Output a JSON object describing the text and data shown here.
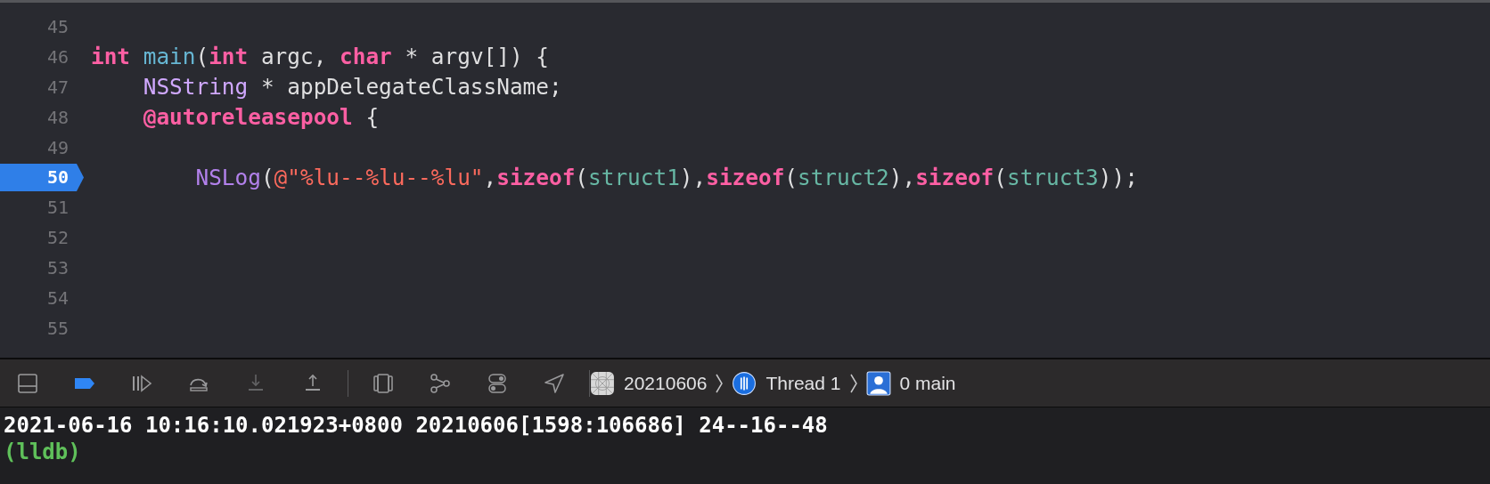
{
  "editor": {
    "lines": [
      {
        "number": "45",
        "breakpoint": false
      },
      {
        "number": "46",
        "breakpoint": false,
        "tokens": [
          {
            "text": "int",
            "kind": "keyword"
          },
          {
            "text": " main",
            "kind": "function"
          },
          {
            "text": "(",
            "kind": "plain"
          },
          {
            "text": "int",
            "kind": "keyword"
          },
          {
            "text": " argc, ",
            "kind": "plain"
          },
          {
            "text": "char",
            "kind": "keyword"
          },
          {
            "text": " * argv[]) {",
            "kind": "plain"
          }
        ]
      },
      {
        "number": "47",
        "breakpoint": false,
        "tokens": [
          {
            "text": "    NSString",
            "kind": "class"
          },
          {
            "text": " * appDelegateClassName;",
            "kind": "plain"
          }
        ]
      },
      {
        "number": "48",
        "breakpoint": false,
        "tokens": [
          {
            "text": "    @autoreleasepool",
            "kind": "keyword"
          },
          {
            "text": " {",
            "kind": "plain"
          }
        ]
      },
      {
        "number": "49",
        "breakpoint": false
      },
      {
        "number": "50",
        "breakpoint": true,
        "tokens": [
          {
            "text": "        NSLog",
            "kind": "call"
          },
          {
            "text": "(",
            "kind": "plain"
          },
          {
            "text": "@\"%lu--%lu--%lu\"",
            "kind": "string"
          },
          {
            "text": ",",
            "kind": "plain"
          },
          {
            "text": "sizeof",
            "kind": "keyword"
          },
          {
            "text": "(",
            "kind": "plain"
          },
          {
            "text": "struct1",
            "kind": "identifier"
          },
          {
            "text": "),",
            "kind": "plain"
          },
          {
            "text": "sizeof",
            "kind": "keyword"
          },
          {
            "text": "(",
            "kind": "plain"
          },
          {
            "text": "struct2",
            "kind": "identifier"
          },
          {
            "text": "),",
            "kind": "plain"
          },
          {
            "text": "sizeof",
            "kind": "keyword"
          },
          {
            "text": "(",
            "kind": "plain"
          },
          {
            "text": "struct3",
            "kind": "identifier"
          },
          {
            "text": "));",
            "kind": "plain"
          }
        ]
      },
      {
        "number": "51",
        "breakpoint": false
      },
      {
        "number": "52",
        "breakpoint": false
      },
      {
        "number": "53",
        "breakpoint": false
      },
      {
        "number": "54",
        "breakpoint": false
      },
      {
        "number": "55",
        "breakpoint": false
      }
    ]
  },
  "debug_bar": {
    "buttons": [
      {
        "kind": "panel",
        "active": false,
        "disabled": false
      },
      {
        "kind": "breakpoints",
        "active": true,
        "disabled": false
      },
      {
        "kind": "continue",
        "active": false,
        "disabled": false
      },
      {
        "kind": "step-over",
        "active": false,
        "disabled": false
      },
      {
        "kind": "step-into",
        "active": false,
        "disabled": true
      },
      {
        "kind": "step-out",
        "active": false,
        "disabled": false
      },
      {
        "kind": "view-hierarchy",
        "active": false,
        "disabled": false
      },
      {
        "kind": "memory-graph",
        "active": false,
        "disabled": false
      },
      {
        "kind": "environment",
        "active": false,
        "disabled": false
      },
      {
        "kind": "location",
        "active": false,
        "disabled": false
      }
    ],
    "breadcrumbs": [
      {
        "kind": "app",
        "label": "20210606"
      },
      {
        "kind": "thread",
        "label": "Thread 1"
      },
      {
        "kind": "frame",
        "label": "0 main"
      }
    ]
  },
  "console": {
    "lines": [
      {
        "kind": "output",
        "text": "2021-06-16 10:16:10.021923+0800 20210606[1598:106686] 24--16--48"
      },
      {
        "kind": "prompt",
        "text": "(lldb)"
      }
    ]
  }
}
